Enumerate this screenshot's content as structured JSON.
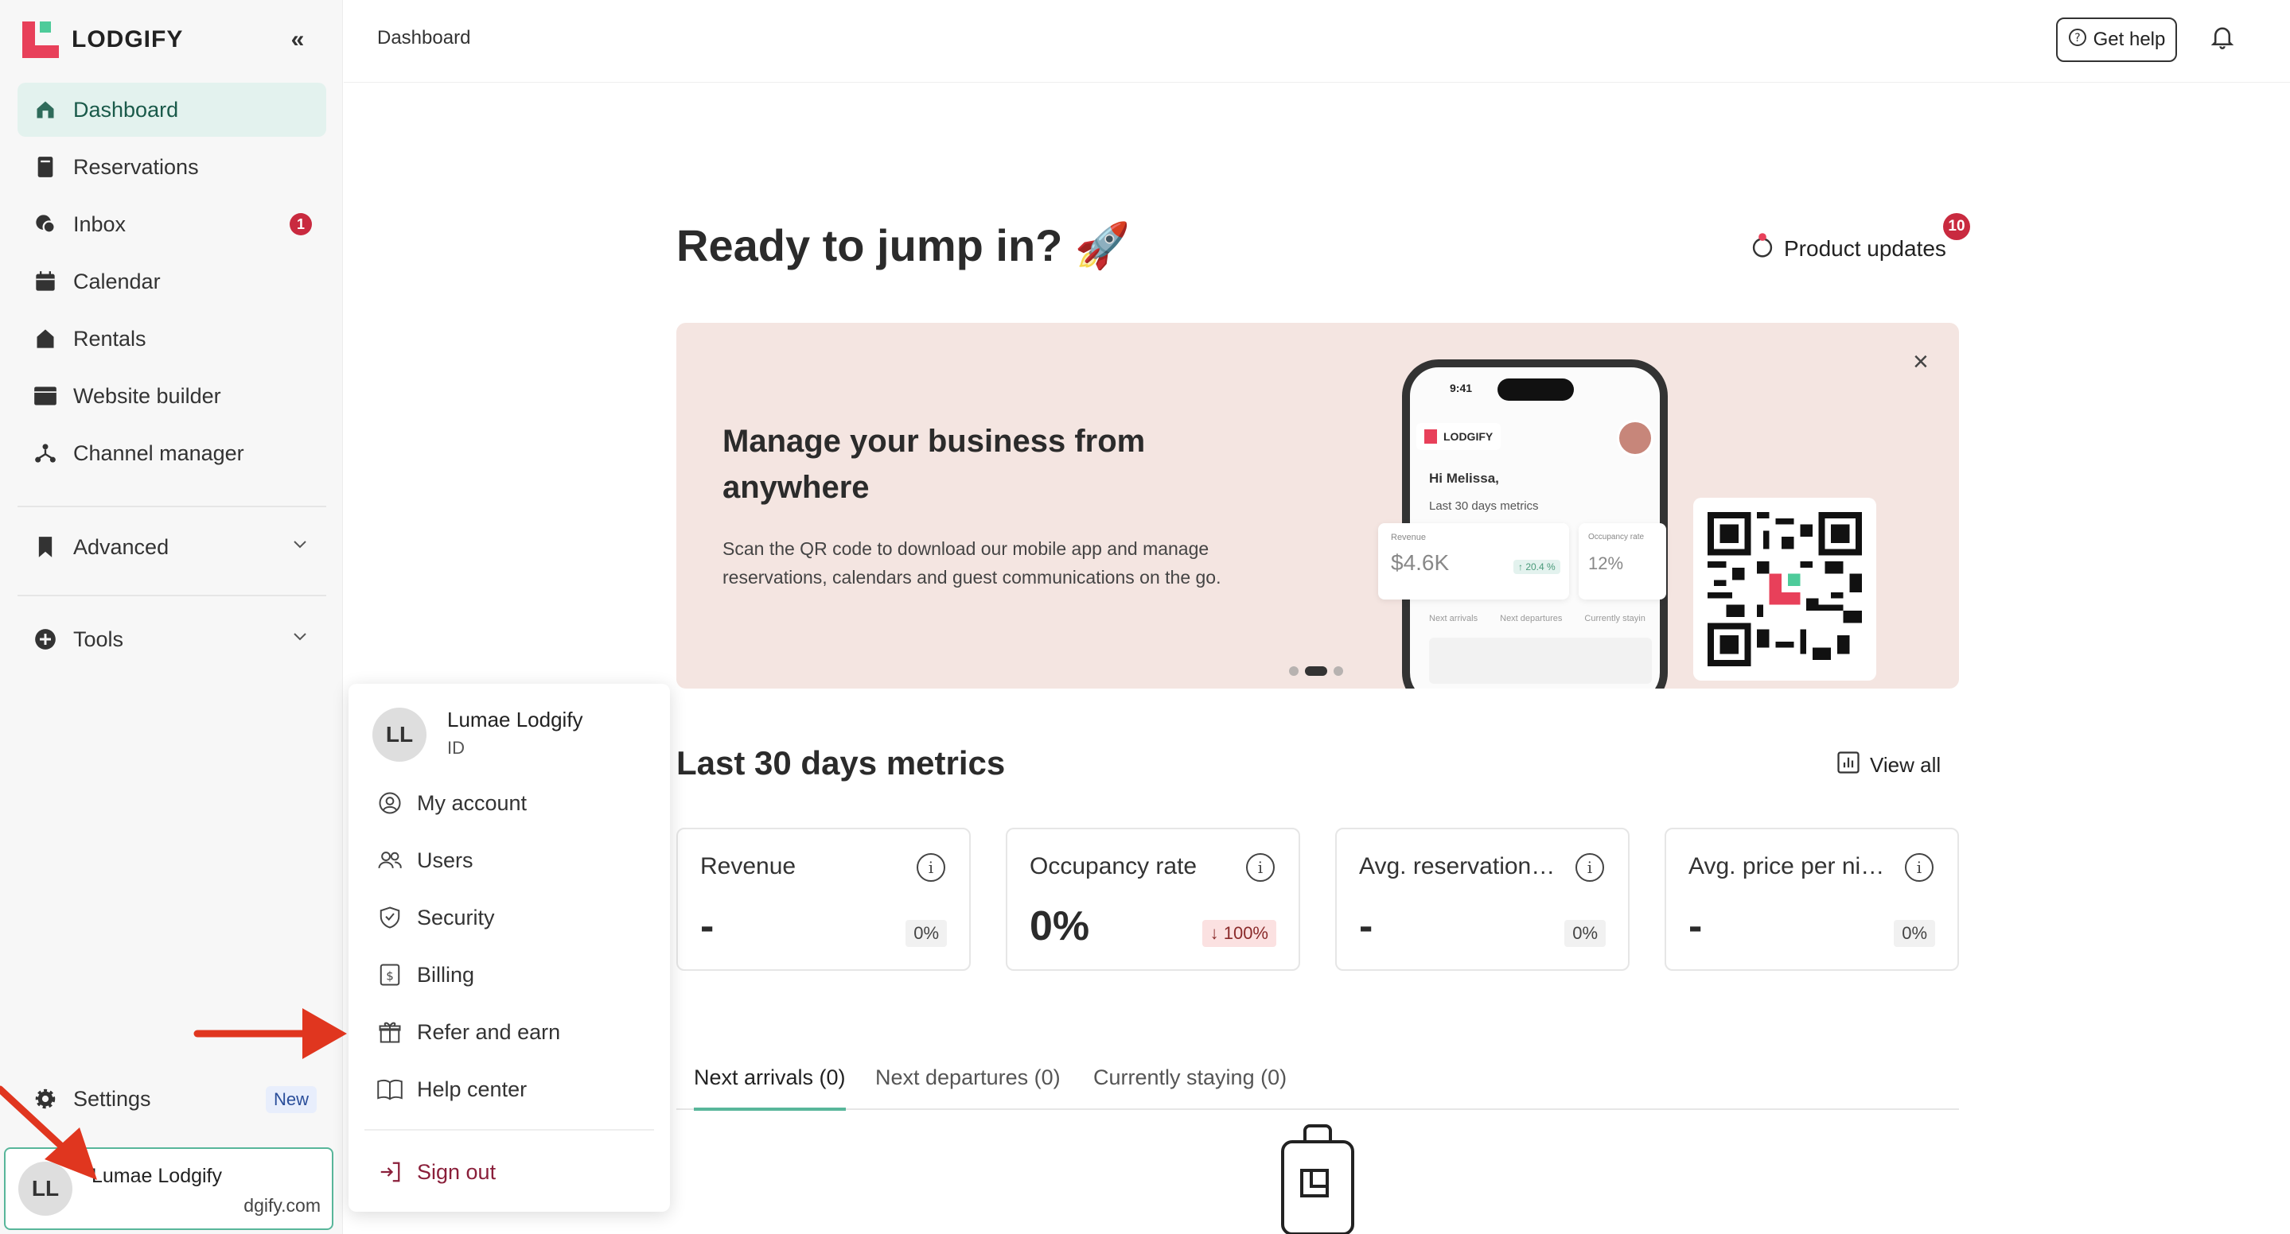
{
  "app": {
    "logo_text": "LODGIFY",
    "collapse_glyph": "«"
  },
  "sidebar": {
    "items": [
      {
        "label": "Dashboard",
        "icon": "home-icon",
        "active": true
      },
      {
        "label": "Reservations",
        "icon": "book-icon"
      },
      {
        "label": "Inbox",
        "icon": "chat-icon",
        "badge": "1"
      },
      {
        "label": "Calendar",
        "icon": "calendar-icon"
      },
      {
        "label": "Rentals",
        "icon": "house-icon"
      },
      {
        "label": "Website builder",
        "icon": "browser-icon"
      },
      {
        "label": "Channel manager",
        "icon": "network-icon"
      }
    ],
    "advanced_label": "Advanced",
    "tools_label": "Tools",
    "settings_label": "Settings",
    "settings_badge": "New",
    "user": {
      "initials": "LL",
      "name": "Lumae Lodgify",
      "email": "dgify.com"
    }
  },
  "header": {
    "breadcrumb": "Dashboard",
    "help_label": "Get help"
  },
  "main": {
    "headline": "Ready to jump in? 🚀",
    "product_updates_label": "Product updates",
    "product_updates_count": "10",
    "banner": {
      "title": "Manage your business from anywhere",
      "text": "Scan the QR code to download our mobile app and manage reservations, calendars and guest communications on the go.",
      "close_glyph": "×",
      "phone": {
        "time": "9:41",
        "logo": "LODGIFY",
        "greeting": "Hi Melissa,",
        "subtitle": "Last 30 days metrics",
        "revenue_label": "Revenue",
        "revenue_value": "$4.6K",
        "revenue_change": "↑ 20.4 %",
        "occupancy_label": "Occupancy rate",
        "occupancy_value": "12%",
        "tabs": [
          "Next arrivals",
          "Next departures",
          "Currently stayin"
        ]
      }
    },
    "metrics_title": "Last 30 days metrics",
    "view_all_label": "View all",
    "metrics": [
      {
        "title": "Revenue",
        "value": "-",
        "change": "0%",
        "trend": "flat"
      },
      {
        "title": "Occupancy rate",
        "value": "0%",
        "change": "↓ 100%",
        "trend": "down"
      },
      {
        "title": "Avg. reservation…",
        "value": "-",
        "change": "0%",
        "trend": "flat"
      },
      {
        "title": "Avg. price per ni…",
        "value": "-",
        "change": "0%",
        "trend": "flat"
      }
    ],
    "tabs": [
      "Next arrivals (0)",
      "Next departures (0)",
      "Currently staying (0)"
    ]
  },
  "account_menu": {
    "initials": "LL",
    "name": "Lumae Lodgify",
    "id_label": "ID",
    "items": [
      {
        "label": "My account",
        "icon": "user-circle-icon"
      },
      {
        "label": "Users",
        "icon": "users-icon"
      },
      {
        "label": "Security",
        "icon": "shield-icon"
      },
      {
        "label": "Billing",
        "icon": "billing-icon"
      },
      {
        "label": "Refer and earn",
        "icon": "gift-icon"
      },
      {
        "label": "Help center",
        "icon": "book-open-icon"
      }
    ],
    "signout_label": "Sign out"
  },
  "colors": {
    "accent": "#58b69a",
    "brand": "#e8405a",
    "annotation": "#e0361f",
    "badge": "#c92a3f"
  }
}
